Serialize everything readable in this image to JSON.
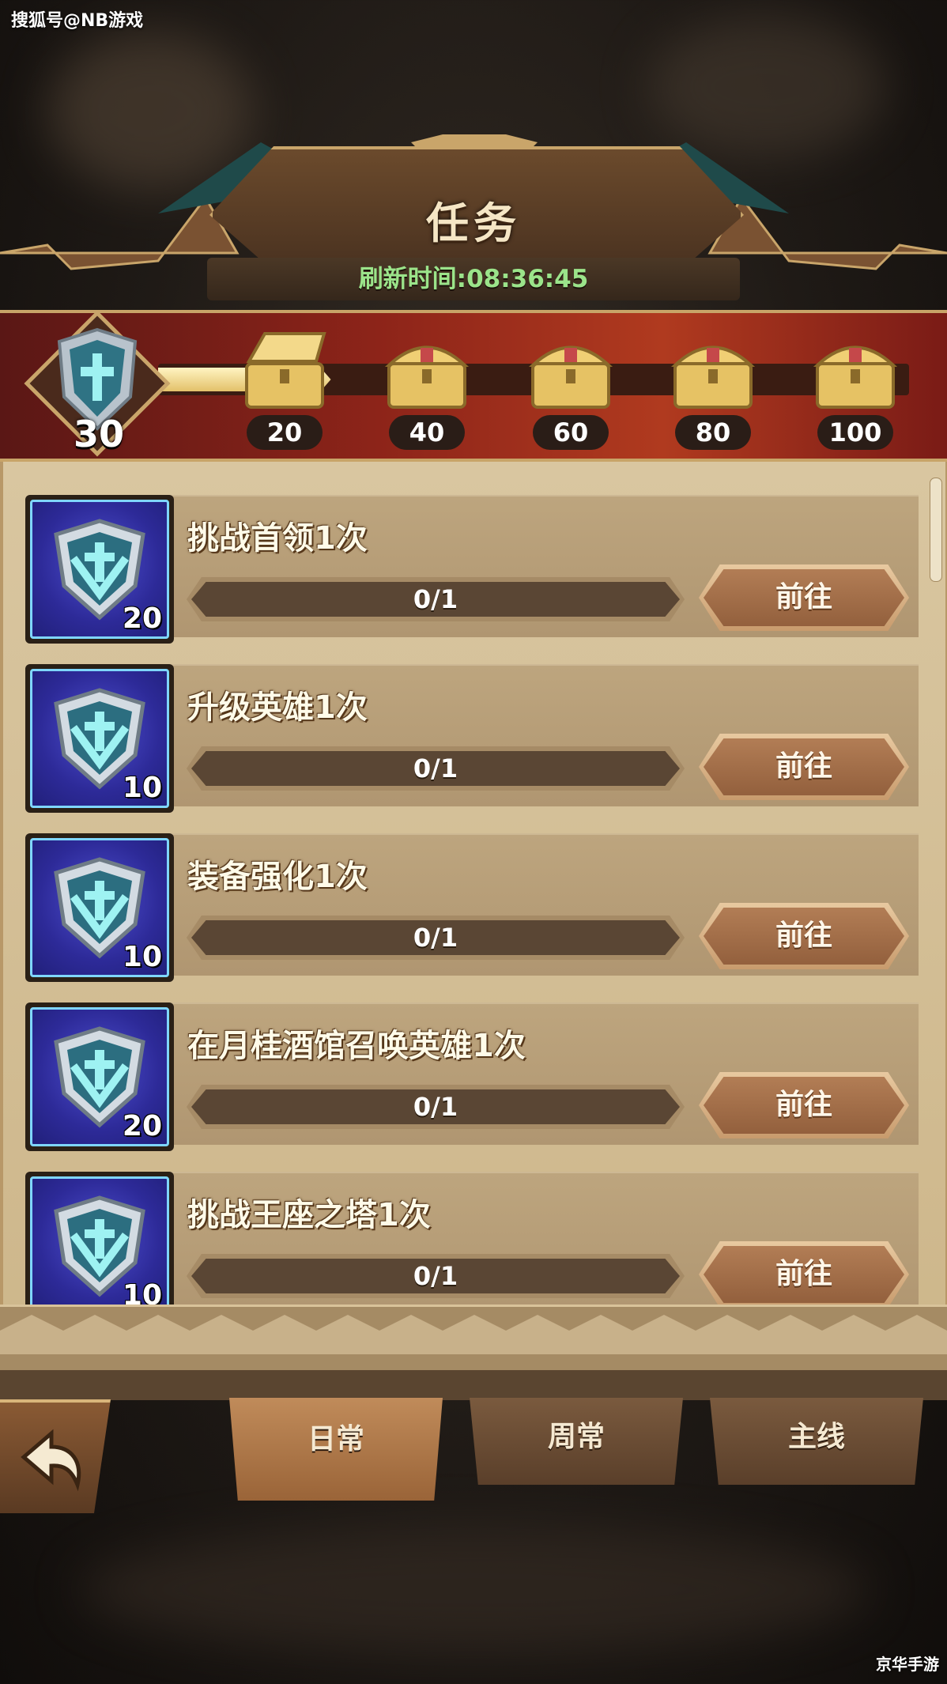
{
  "watermark_top": "搜狐号@NB游戏",
  "watermark_bottom": "京华手游",
  "header": {
    "title": "任务",
    "refresh_label": "刷新时间:08:36:45"
  },
  "activity": {
    "current_points": "30",
    "progress_fraction": 0.23,
    "chests": [
      {
        "label": "20",
        "state": "opened"
      },
      {
        "label": "40",
        "state": "locked"
      },
      {
        "label": "60",
        "state": "locked"
      },
      {
        "label": "80",
        "state": "locked"
      },
      {
        "label": "100",
        "state": "locked"
      }
    ]
  },
  "tasks": [
    {
      "title": "挑战首领1次",
      "points": "20",
      "progress": "0/1",
      "button": "前往"
    },
    {
      "title": "升级英雄1次",
      "points": "10",
      "progress": "0/1",
      "button": "前往"
    },
    {
      "title": "装备强化1次",
      "points": "10",
      "progress": "0/1",
      "button": "前往"
    },
    {
      "title": "在月桂酒馆召唤英雄1次",
      "points": "20",
      "progress": "0/1",
      "button": "前往"
    },
    {
      "title": "挑战王座之塔1次",
      "points": "10",
      "progress": "0/1",
      "button": "前往"
    }
  ],
  "tabs": [
    {
      "label": "日常",
      "active": true
    },
    {
      "label": "周常",
      "active": false
    },
    {
      "label": "主线",
      "active": false
    }
  ],
  "icons": {
    "task_icon": "shield-icon",
    "chest_icon": "treasure-chest-icon",
    "back_icon": "back-arrow-icon"
  },
  "colors": {
    "refresh_text": "#9be48a",
    "band_red": "#8d2419",
    "panel": "#d9c6a0"
  }
}
